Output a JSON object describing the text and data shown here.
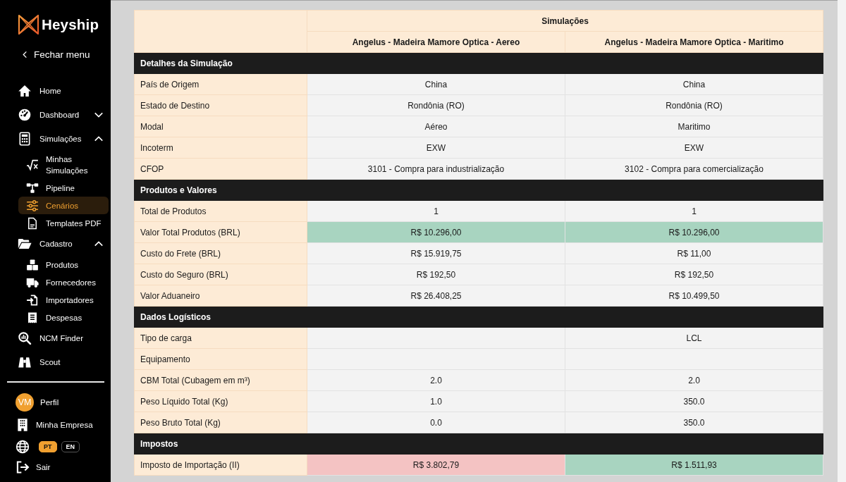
{
  "sidebar": {
    "brand": "Heyship",
    "collapse_label": "Fechar menu",
    "items": [
      {
        "label": "Home",
        "selected": false
      },
      {
        "label": "Dashboard",
        "selected": false,
        "expanded": false
      },
      {
        "label": "Simulações",
        "selected": false,
        "expanded": true,
        "children": [
          {
            "label": "Minhas Simulações",
            "selected": false
          },
          {
            "label": "Pipeline",
            "selected": false
          },
          {
            "label": "Cenários",
            "selected": true
          },
          {
            "label": "Templates PDF",
            "selected": false
          }
        ]
      },
      {
        "label": "Cadastro",
        "selected": false,
        "expanded": true,
        "children": [
          {
            "label": "Produtos",
            "selected": false
          },
          {
            "label": "Fornecedores",
            "selected": false
          },
          {
            "label": "Importadores",
            "selected": false
          },
          {
            "label": "Despesas",
            "selected": false
          }
        ]
      },
      {
        "label": "NCM Finder",
        "selected": false
      },
      {
        "label": "Scout",
        "selected": false
      }
    ]
  },
  "account": {
    "avatar_initials": "VM",
    "profile_label": "Perfil",
    "company_label": "Minha Empresa",
    "languages": [
      {
        "label": "PT",
        "selected": true
      },
      {
        "label": "EN",
        "selected": false
      }
    ],
    "logout_label": "Sair"
  },
  "table": {
    "group_header": "Simulações",
    "columns": [
      "Angelus - Madeira Mamore Optica - Aereo",
      "Angelus - Madeira Mamore Optica - Maritimo"
    ],
    "sections": [
      {
        "title": "Detalhes da Simulação",
        "rows": [
          {
            "label": "País de Origem",
            "column_1": {
              "text": "China"
            },
            "column_2": {
              "text": "China"
            }
          },
          {
            "label": "Estado de Destino",
            "column_1": {
              "text": "Rondônia (RO)"
            },
            "column_2": {
              "text": "Rondônia (RO)"
            }
          },
          {
            "label": "Modal",
            "column_1": {
              "text": "Aéreo"
            },
            "column_2": {
              "text": "Maritimo"
            }
          },
          {
            "label": "Incoterm",
            "column_1": {
              "text": "EXW"
            },
            "column_2": {
              "text": "EXW"
            }
          },
          {
            "label": "CFOP",
            "column_1": {
              "text": "3101 - Compra para industrialização"
            },
            "column_2": {
              "text": "3102 - Compra para comercialização"
            }
          }
        ]
      },
      {
        "title": "Produtos e Valores",
        "rows": [
          {
            "label": "Total de Produtos",
            "column_1": {
              "text": "1"
            },
            "column_2": {
              "text": "1"
            }
          },
          {
            "label": "Valor Total Produtos (BRL)",
            "column_1": {
              "text": "R$ 10.296,00",
              "color": "#a8d4c0"
            },
            "column_2": {
              "text": "R$ 10.296,00",
              "color": "#a8d4c0"
            }
          },
          {
            "label": "Custo do Frete (BRL)",
            "column_1": {
              "text": "R$ 15.919,75"
            },
            "column_2": {
              "text": "R$ 11,00"
            }
          },
          {
            "label": "Custo do Seguro (BRL)",
            "column_1": {
              "text": "R$ 192,50"
            },
            "column_2": {
              "text": "R$ 192,50"
            }
          },
          {
            "label": "Valor Aduaneiro",
            "column_1": {
              "text": "R$ 26.408,25"
            },
            "column_2": {
              "text": "R$ 10.499,50"
            }
          }
        ]
      },
      {
        "title": "Dados Logísticos",
        "rows": [
          {
            "label": "Tipo de carga",
            "column_2": {
              "text": "LCL"
            }
          },
          {
            "label": "Equipamento"
          },
          {
            "label": "CBM Total (Cubagem em m³)",
            "column_1": {
              "text": "2.0"
            },
            "column_2": {
              "text": "2.0"
            }
          },
          {
            "label": "Peso Líquido Total (Kg)",
            "column_1": {
              "text": "1.0"
            },
            "column_2": {
              "text": "350.0"
            }
          },
          {
            "label": "Peso Bruto Total (Kg)",
            "column_1": {
              "text": "0.0"
            },
            "column_2": {
              "text": "350.0"
            }
          }
        ]
      },
      {
        "title": "Impostos",
        "rows": [
          {
            "label": "Imposto de Importação (II)",
            "column_1": {
              "text": "R$ 3.802,79",
              "color": "#f4c3c3"
            },
            "column_2": {
              "text": "R$ 1.511,93",
              "color": "#a8d4c0"
            }
          }
        ]
      }
    ]
  }
}
